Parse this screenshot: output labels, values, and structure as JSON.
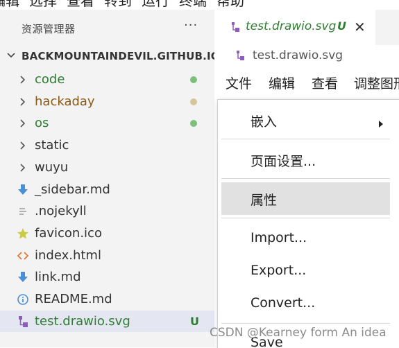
{
  "top_menu": [
    "编辑",
    "选择",
    "查看",
    "转到",
    "运行",
    "终端",
    "帮助"
  ],
  "sidebar": {
    "title": "资源管理器",
    "more": "···",
    "root": "BACKMOUNTAINDEVIL.GITHUB.IO",
    "items": [
      {
        "label": "code",
        "kind": "folder",
        "color": "#2e7d32",
        "dot": "#7cc07c"
      },
      {
        "label": "hackaday",
        "kind": "folder",
        "color": "#8a5a14",
        "dot": "#d6c59a"
      },
      {
        "label": "os",
        "kind": "folder",
        "color": "#2e7d32",
        "dot": "#7cc07c"
      },
      {
        "label": "static",
        "kind": "folder",
        "color": "#333333"
      },
      {
        "label": "wuyu",
        "kind": "folder",
        "color": "#333333"
      },
      {
        "label": "_sidebar.md",
        "kind": "md-arrow",
        "color": "#333333"
      },
      {
        "label": ".nojekyll",
        "kind": "text-file",
        "color": "#333333"
      },
      {
        "label": "favicon.ico",
        "kind": "star",
        "color": "#333333"
      },
      {
        "label": "index.html",
        "kind": "html",
        "color": "#333333"
      },
      {
        "label": "link.md",
        "kind": "md-arrow",
        "color": "#333333"
      },
      {
        "label": "README.md",
        "kind": "info",
        "color": "#333333"
      },
      {
        "label": "test.drawio.svg",
        "kind": "drawio",
        "color": "#2e7d32",
        "badge": "U",
        "selected": true
      }
    ]
  },
  "tab": {
    "title": "test.drawio.svg",
    "badge": "U",
    "close": "✕"
  },
  "breadcrumb": "test.drawio.svg",
  "app_menu": [
    "文件",
    "编辑",
    "查看",
    "调整图形"
  ],
  "dropdown": {
    "items": [
      "嵌入",
      "页面设置...",
      "属性",
      "Import...",
      "Export...",
      "Convert...",
      "Save"
    ]
  },
  "watermark": "CSDN @Kearney form An idea",
  "colors": {
    "accent_green": "#2e7d32",
    "sidebar_bg": "#f3f3f3",
    "selected_bg": "#e4e6f1",
    "hover_bg": "#e1e1e1",
    "drawio_purple": "#8e5cc0"
  }
}
